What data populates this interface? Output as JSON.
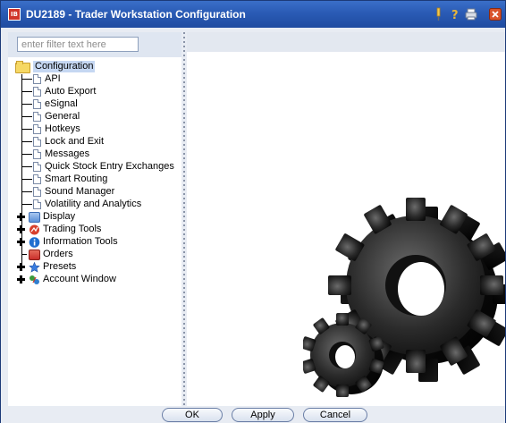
{
  "window": {
    "title": "DU2189 - Trader Workstation Configuration",
    "app_icon_text": "IB"
  },
  "filter": {
    "placeholder": "enter filter text here",
    "value": ""
  },
  "tree": {
    "root_label": "Configuration",
    "children": [
      {
        "label": "API"
      },
      {
        "label": "Auto Export"
      },
      {
        "label": "eSignal"
      },
      {
        "label": "General"
      },
      {
        "label": "Hotkeys"
      },
      {
        "label": "Lock and Exit"
      },
      {
        "label": "Messages"
      },
      {
        "label": "Quick Stock Entry Exchanges"
      },
      {
        "label": "Smart Routing"
      },
      {
        "label": "Sound Manager"
      },
      {
        "label": "Volatility and Analytics"
      }
    ],
    "groups": [
      {
        "label": "Display",
        "icon": "display-icon",
        "color": "#5b8fd6",
        "expandable": true
      },
      {
        "label": "Trading Tools",
        "icon": "trading-tools-icon",
        "color": "#d8402c",
        "expandable": true
      },
      {
        "label": "Information Tools",
        "icon": "info-icon",
        "color": "#1f6fd0",
        "expandable": true
      },
      {
        "label": "Orders",
        "icon": "orders-icon",
        "color": "#c9302c",
        "expandable": false
      },
      {
        "label": "Presets",
        "icon": "presets-icon",
        "color": "#3a7de0",
        "expandable": true
      },
      {
        "label": "Account Window",
        "icon": "account-window-icon",
        "color": "#3c9a3c",
        "expandable": true
      }
    ]
  },
  "buttons": {
    "ok": "OK",
    "apply": "Apply",
    "cancel": "Cancel"
  },
  "colors": {
    "titlebar": "#2a5bb5",
    "selection": "#c5d7f2"
  }
}
